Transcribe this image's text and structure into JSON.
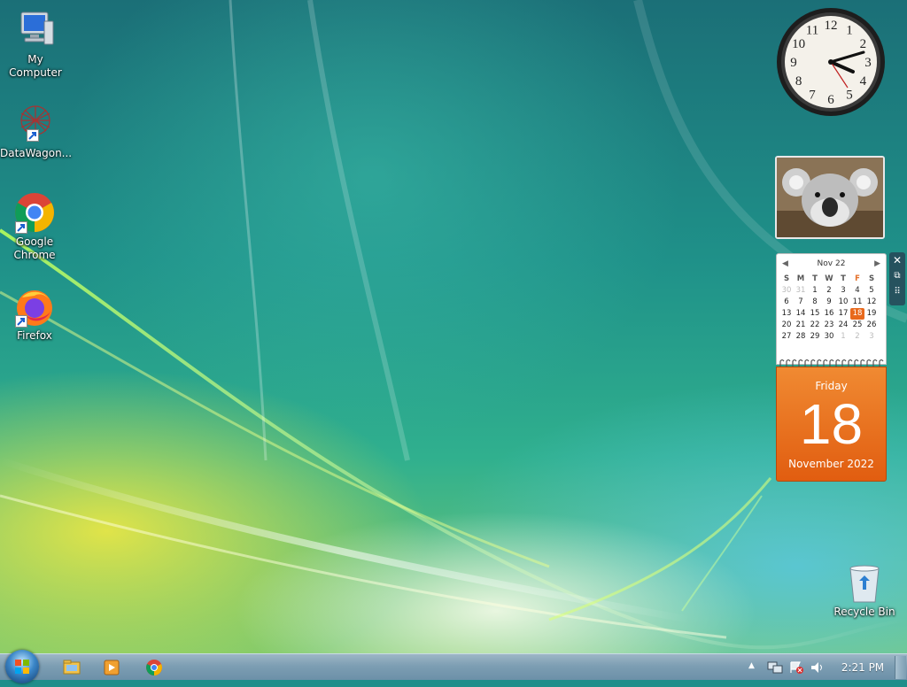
{
  "desktop": {
    "icons": [
      {
        "label": "My Computer"
      },
      {
        "label": "DataWagon..."
      },
      {
        "label": "Google Chrome"
      },
      {
        "label": "Firefox"
      }
    ],
    "recycle_bin": {
      "label": "Recycle Bin"
    }
  },
  "calendar": {
    "month_label": "Nov 22",
    "weekdays": [
      "S",
      "M",
      "T",
      "W",
      "T",
      "F",
      "S"
    ],
    "days": [
      [
        "30",
        "31",
        "1",
        "2",
        "3",
        "4",
        "5"
      ],
      [
        "6",
        "7",
        "8",
        "9",
        "10",
        "11",
        "12"
      ],
      [
        "13",
        "14",
        "15",
        "16",
        "17",
        "18",
        "19"
      ],
      [
        "20",
        "21",
        "22",
        "23",
        "24",
        "25",
        "26"
      ],
      [
        "27",
        "28",
        "29",
        "30",
        "1",
        "2",
        "3"
      ]
    ],
    "today": "18",
    "weekday": "Friday",
    "day": "18",
    "month_year": "November 2022",
    "accent": "#e8691c"
  },
  "clock_gadget": {
    "numerals": [
      "12",
      "1",
      "2",
      "3",
      "4",
      "5",
      "6",
      "7",
      "8",
      "9",
      "10",
      "11"
    ]
  },
  "taskbar": {
    "time": "2:21 PM",
    "buttons": [
      "start-orb",
      "file-explorer-icon",
      "media-player-icon",
      "chrome-icon"
    ],
    "tray_icons": [
      "show-hidden-icons-icon",
      "network-icon",
      "action-center-icon",
      "volume-icon"
    ]
  }
}
